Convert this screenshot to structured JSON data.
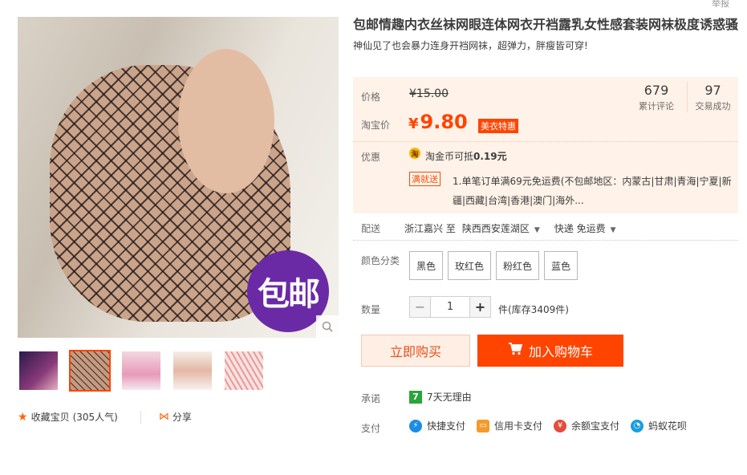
{
  "report": "举报",
  "gallery": {
    "promo_badge": "包邮",
    "thumbnails": [
      "thumb-1",
      "thumb-2",
      "thumb-3",
      "thumb-4",
      "thumb-5"
    ],
    "active_thumb": 1
  },
  "favorites": {
    "label": "收藏宝贝",
    "count": "(305人气)",
    "share": "分享"
  },
  "product": {
    "title": "包邮情趣内衣丝袜网眼连体网衣开裆露乳女性感套装网袜极度诱惑骚",
    "subtitle": "神仙见了也会暴力连身开裆网袜，超弹力，胖瘦皆可穿!"
  },
  "price": {
    "orig_label": "价格",
    "orig_value": "¥15.00",
    "tb_label": "淘宝价",
    "currency": "¥",
    "tb_value": "9.80",
    "promo_tag": "美衣特惠",
    "stats": [
      {
        "num": "679",
        "label": "累计评论"
      },
      {
        "num": "97",
        "label": "交易成功"
      }
    ],
    "discount_label": "优惠",
    "coin_text": "淘金币可抵",
    "coin_amount": "0.19元",
    "manjiu_tag": "满就送",
    "manjiu_text": "1.单笔订单满69元免运费(不包邮地区：内蒙古|甘肃|青海|宁夏|新疆|西藏|台湾|香港|澳门|海外..."
  },
  "shipping": {
    "label": "配送",
    "from": "浙江嘉兴 至",
    "to": "陕西西安莲湖区",
    "method": "快递 免运费"
  },
  "colors": {
    "label": "颜色分类",
    "options": [
      "黑色",
      "玫红色",
      "粉红色",
      "蓝色"
    ]
  },
  "quantity": {
    "label": "数量",
    "value": "1",
    "stock": "件(库存3409件)"
  },
  "actions": {
    "buy_now": "立即购买",
    "add_cart": "加入购物车"
  },
  "promise": {
    "label": "承诺",
    "icon_text": "7",
    "text": "7天无理由"
  },
  "payment": {
    "label": "支付",
    "methods": [
      "快捷支付",
      "信用卡支付",
      "余额宝支付",
      "蚂蚁花呗"
    ]
  },
  "colors_theme": {
    "accent": "#ff4400",
    "price_bg": "#fff2e8",
    "promo_purple": "#6a2aa5"
  }
}
